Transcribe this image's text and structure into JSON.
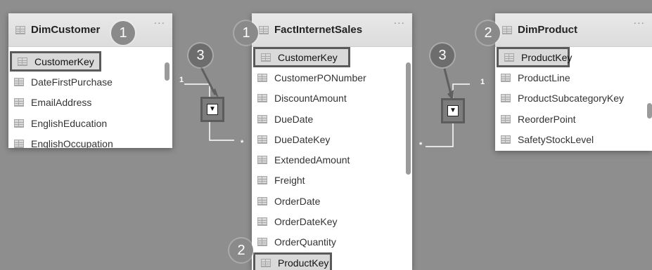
{
  "colors": {
    "canvas": "#8e8e8e",
    "card": "#ffffff",
    "header": "#e0e0e0",
    "highlight_border": "#5a5a5a",
    "callout": "#8a8a8a",
    "connector": "#ffffff"
  },
  "tables": {
    "dimcustomer": {
      "title": "DimCustomer",
      "fields": [
        "CustomerKey",
        "DateFirstPurchase",
        "EmailAddress",
        "EnglishEducation",
        "EnglishOccupation"
      ]
    },
    "factinternetsales": {
      "title": "FactInternetSales",
      "fields": [
        "CustomerKey",
        "CustomerPONumber",
        "DiscountAmount",
        "DueDate",
        "DueDateKey",
        "ExtendedAmount",
        "Freight",
        "OrderDate",
        "OrderDateKey",
        "OrderQuantity",
        "ProductKey"
      ]
    },
    "dimproduct": {
      "title": "DimProduct",
      "fields": [
        "ProductKey",
        "ProductLine",
        "ProductSubcategoryKey",
        "ReorderPoint",
        "SafetyStockLevel"
      ]
    }
  },
  "ui": {
    "more_label": "...",
    "filter_arrow": "▼",
    "table_icon": "table-icon"
  },
  "callouts": {
    "c1a": "1",
    "c1b": "1",
    "c2a": "2",
    "c2b": "2",
    "c3a": "3",
    "c3b": "3"
  },
  "cardinality": {
    "left_one": "1",
    "left_many": "*",
    "right_one": "1",
    "right_many": "*"
  }
}
